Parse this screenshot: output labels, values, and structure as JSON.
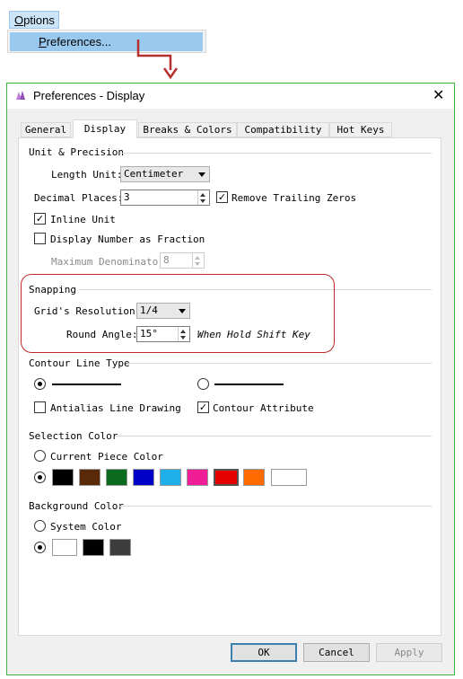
{
  "menu": {
    "title": "Options",
    "title_ul": "O",
    "title_rest": "ptions",
    "item": "Preferences...",
    "item_ul": "P",
    "item_rest": "references..."
  },
  "dialog": {
    "title": "Preferences - Display",
    "tabs": [
      "General",
      "Display",
      "Breaks & Colors",
      "Compatibility",
      "Hot Keys"
    ],
    "active_tab": "Display",
    "unit_precision": {
      "heading": "Unit & Precision",
      "length_unit_label": "Length Unit:",
      "length_unit_value": "Centimeter",
      "decimal_places_label": "Decimal Places:",
      "decimal_places_value": "3",
      "remove_trailing_zeros": "Remove Trailing Zeros",
      "remove_trailing_zeros_checked": true,
      "inline_unit": "Inline Unit",
      "inline_unit_checked": true,
      "display_fraction": "Display Number as Fraction",
      "display_fraction_checked": false,
      "max_denominator_label": "Maximum Denominator",
      "max_denominator_value": "8"
    },
    "snapping": {
      "heading": "Snapping",
      "grid_resolution_label": "Grid's Resolution:",
      "grid_resolution_value": "1/4",
      "round_angle_label": "Round Angle:",
      "round_angle_value": "15°",
      "shift_hint": "When Hold Shift Key"
    },
    "contour": {
      "heading": "Contour Line Type",
      "selected_index": 0,
      "antialias": "Antialias Line Drawing",
      "antialias_checked": false,
      "contour_attribute": "Contour Attribute",
      "contour_attribute_checked": true
    },
    "selection_color": {
      "heading": "Selection Color",
      "current_piece": "Current Piece Color",
      "current_piece_selected": false,
      "palette_selected": true,
      "swatches": [
        "#000000",
        "#5a2a08",
        "#0a6b1e",
        "#0000c8",
        "#1eaee8",
        "#f01e96",
        "#e60000",
        "#ff6a00",
        "#ffffff"
      ],
      "selected_swatch_index": 6
    },
    "background_color": {
      "heading": "Background Color",
      "system_color": "System Color",
      "system_selected": false,
      "palette_selected": true,
      "swatches": [
        "#ffffff",
        "#000000",
        "#3c3c3c"
      ]
    },
    "buttons": {
      "ok": "OK",
      "cancel": "Cancel",
      "apply": "Apply"
    }
  }
}
